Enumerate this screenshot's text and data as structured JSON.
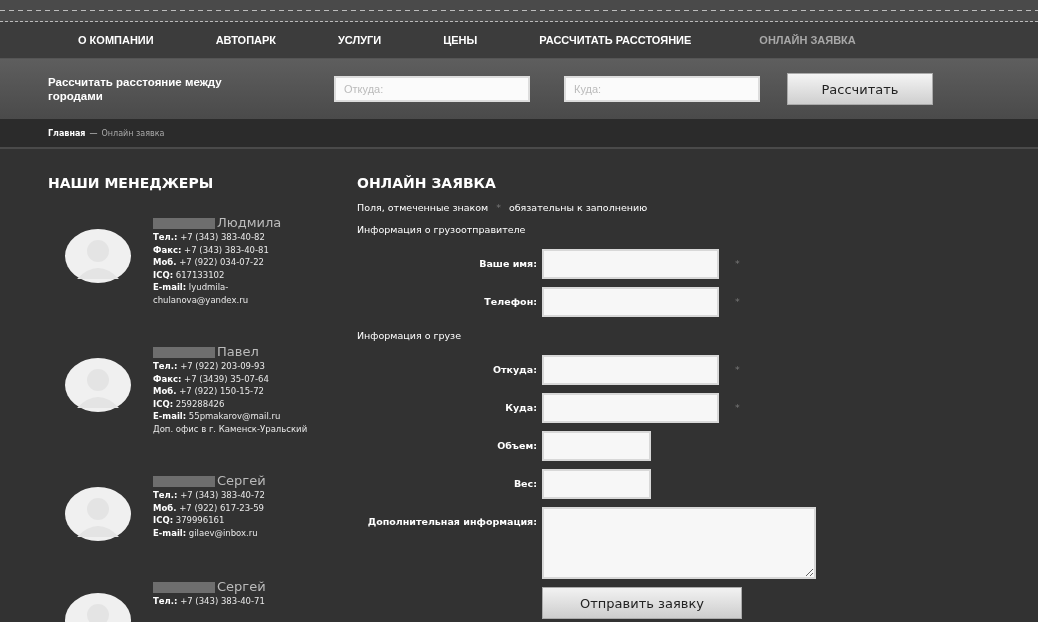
{
  "nav": [
    {
      "label": "О КОМПАНИИ",
      "selected": false
    },
    {
      "label": "АВТОПАРК",
      "selected": false
    },
    {
      "label": "УСЛУГИ",
      "selected": false
    },
    {
      "label": "ЦЕНЫ",
      "selected": false
    },
    {
      "label": "РАССЧИТАТЬ РАССТОЯНИЕ",
      "selected": false
    },
    {
      "label": "ОНЛАЙН ЗАЯВКА",
      "selected": true
    }
  ],
  "calculator": {
    "title": "Рассчитать расстояние между городами",
    "from_placeholder": "Откуда:",
    "to_placeholder": "Куда:",
    "button": "Рассчитать"
  },
  "breadcrumbs": [
    {
      "label": "Главная",
      "selected": false
    },
    {
      "label": "Онлайн заявка",
      "selected": true
    }
  ],
  "breadcrumb_separator": "—",
  "managers_title": "НАШИ МЕНЕДЖЕРЫ",
  "managers": [
    {
      "surname_redacted": true,
      "name": "Людмила",
      "lines": [
        {
          "label": "Тел.:",
          "value": "+7 (343) 383-40-82"
        },
        {
          "label": "Факс:",
          "value": "+7 (343) 383-40-81"
        },
        {
          "label": "Моб.",
          "value": "+7 (922) 034-07-22"
        },
        {
          "label": "ICQ:",
          "value": "617133102"
        },
        {
          "label": "E-mail:",
          "value": "lyudmila-chulanova@yandex.ru"
        }
      ]
    },
    {
      "surname_redacted": true,
      "name": "Павел",
      "lines": [
        {
          "label": "Тел.:",
          "value": "+7 (922) 203-09-93"
        },
        {
          "label": "Факс:",
          "value": "+7 (3439) 35-07-64"
        },
        {
          "label": "Моб.",
          "value": "+7 (922) 150-15-72"
        },
        {
          "label": "ICQ:",
          "value": "259288426"
        },
        {
          "label": "E-mail:",
          "value": "55pmakarov@mail.ru"
        },
        {
          "value": "Доп. офис в г. Каменск-Уральский"
        }
      ]
    },
    {
      "surname_redacted": true,
      "name": "Сергей",
      "lines": [
        {
          "label": "Тел.:",
          "value": "+7 (343) 383-40-72"
        },
        {
          "label": "Моб.",
          "value": "+7 (922) 617-23-59"
        },
        {
          "label": "ICQ:",
          "value": "379996161"
        },
        {
          "label": "E-mail:",
          "value": "gilaev@inbox.ru"
        }
      ]
    },
    {
      "surname_redacted": true,
      "name": "Сергей",
      "lines": [
        {
          "label": "Тел.:",
          "value": "+7 (343) 383-40-71"
        }
      ]
    }
  ],
  "form": {
    "title": "ОНЛАЙН ЗАЯВКА",
    "note_before": "Поля, отмеченные знаком",
    "note_mark": "*",
    "note_after": "обязательны к заполнению",
    "items": [
      {
        "kind": "section",
        "text": "Информация о грузоотправителе"
      },
      {
        "kind": "input",
        "label": "Ваше имя:",
        "required_mark": "*"
      },
      {
        "kind": "input",
        "label": "Телефон:",
        "required_mark": "*"
      },
      {
        "kind": "section",
        "text": "Информация о грузе"
      },
      {
        "kind": "input",
        "label": "Откуда:",
        "required_mark": "*"
      },
      {
        "kind": "input",
        "label": "Куда:",
        "required_mark": "*"
      },
      {
        "kind": "short_input",
        "label": "Объем:"
      },
      {
        "kind": "short_input",
        "label": "Вес:"
      },
      {
        "kind": "textarea",
        "label": "Дополнительная информация:"
      }
    ],
    "submit": "Отправить заявку"
  }
}
